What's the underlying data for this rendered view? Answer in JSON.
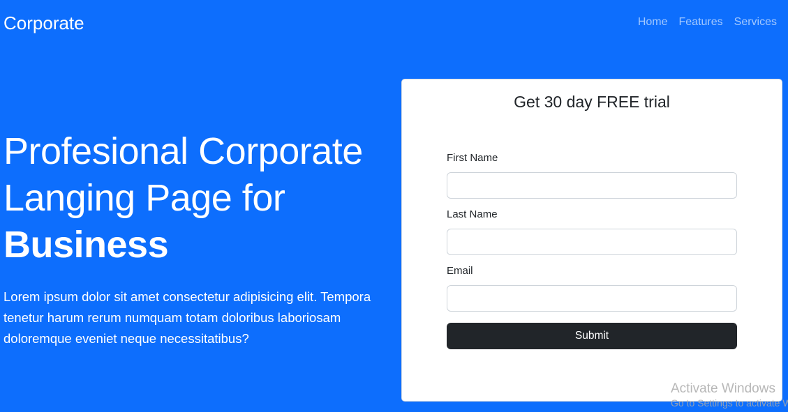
{
  "navbar": {
    "brand": "Corporate",
    "links": [
      {
        "label": "Home"
      },
      {
        "label": "Features"
      },
      {
        "label": "Services"
      }
    ]
  },
  "hero": {
    "title_line1": "Profesional Corporate",
    "title_line2": "Langing Page for",
    "title_strong": "Business",
    "text": "Lorem ipsum dolor sit amet consectetur adipisicing elit. Tempora tenetur harum rerum numquam totam doloribus laboriosam doloremque eveniet neque necessitatibus?"
  },
  "signup_card": {
    "title": "Get 30 day FREE trial",
    "fields": [
      {
        "label": "First Name",
        "value": "",
        "placeholder": ""
      },
      {
        "label": "Last Name",
        "value": "",
        "placeholder": ""
      },
      {
        "label": "Email",
        "value": "",
        "placeholder": ""
      }
    ],
    "submit_label": "Submit"
  },
  "watermark": {
    "title": "Activate Windows",
    "subtitle": "Go to Settings to activate Windows."
  },
  "colors": {
    "background": "#0d6efd",
    "button": "#212529",
    "card": "#ffffff"
  }
}
